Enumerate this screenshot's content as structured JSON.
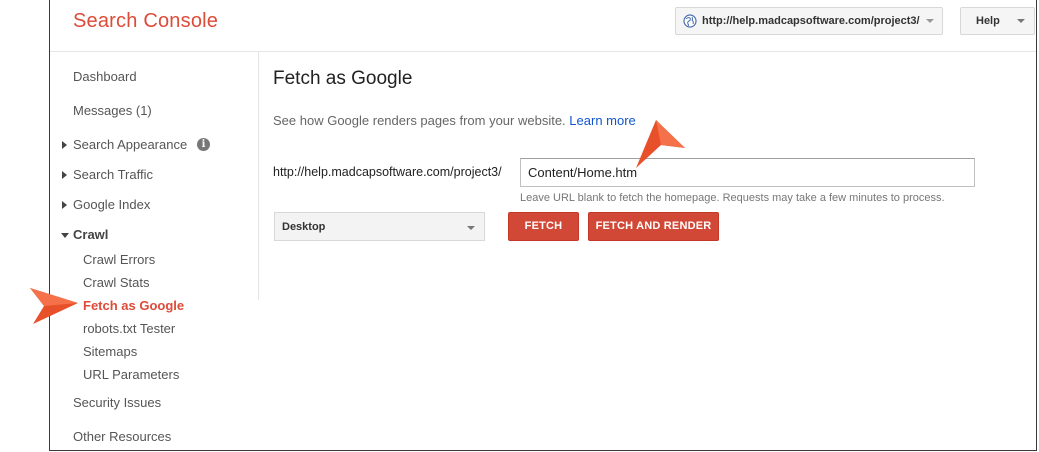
{
  "app": {
    "title": "Search Console"
  },
  "header": {
    "property": "http://help.madcapsoftware.com/project3/",
    "help_label": "Help"
  },
  "sidebar": {
    "dashboard": "Dashboard",
    "messages": "Messages (1)",
    "search_appearance": "Search Appearance",
    "search_traffic": "Search Traffic",
    "google_index": "Google Index",
    "crawl": "Crawl",
    "crawl_items": [
      "Crawl Errors",
      "Crawl Stats",
      "Fetch as Google",
      "robots.txt Tester",
      "Sitemaps",
      "URL Parameters"
    ],
    "security_issues": "Security Issues",
    "other_resources": "Other Resources",
    "info_glyph": "i",
    "active_item": "Fetch as Google"
  },
  "main": {
    "title": "Fetch as Google",
    "description": "See how Google renders pages from your website.",
    "learn_more": "Learn more",
    "url_prefix": "http://help.madcapsoftware.com/project3/",
    "url_value": "Content/Home.htm",
    "hint": "Leave URL blank to fetch the homepage. Requests may take a few minutes to process.",
    "device": "Desktop",
    "fetch_label": "FETCH",
    "fetch_render_label": "FETCH AND RENDER"
  },
  "colors": {
    "brand": "#dd4b39",
    "button": "#d14836",
    "link": "#1155cc",
    "annotation_arrow": "#e8502a"
  }
}
